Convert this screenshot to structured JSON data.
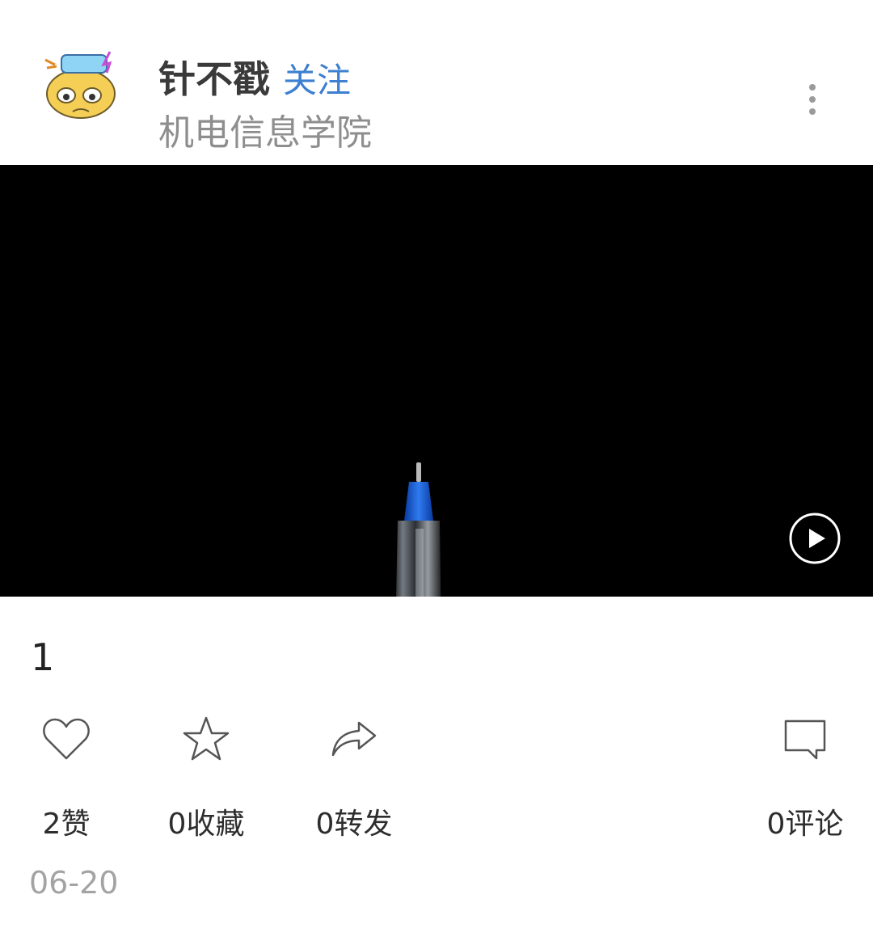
{
  "author": {
    "name": "针不戳",
    "follow_label": "关注",
    "college": "机电信息学院",
    "avatar_icon": "emoji-sticker-avatar"
  },
  "menu": {
    "more_icon": "more-vertical-icon"
  },
  "video": {
    "play_icon": "play-icon"
  },
  "post": {
    "text": "1",
    "date": "06-20"
  },
  "actions": {
    "like": {
      "icon": "heart-icon",
      "label": "2赞"
    },
    "favorite": {
      "icon": "star-icon",
      "label": "0收藏"
    },
    "share": {
      "icon": "share-arrow-icon",
      "label": "0转发"
    },
    "comment": {
      "icon": "comment-bubble-icon",
      "label": "0评论"
    }
  },
  "colors": {
    "follow": "#3d7fd0",
    "secondary_text": "#8e8e8e",
    "video_bg": "#000000"
  }
}
